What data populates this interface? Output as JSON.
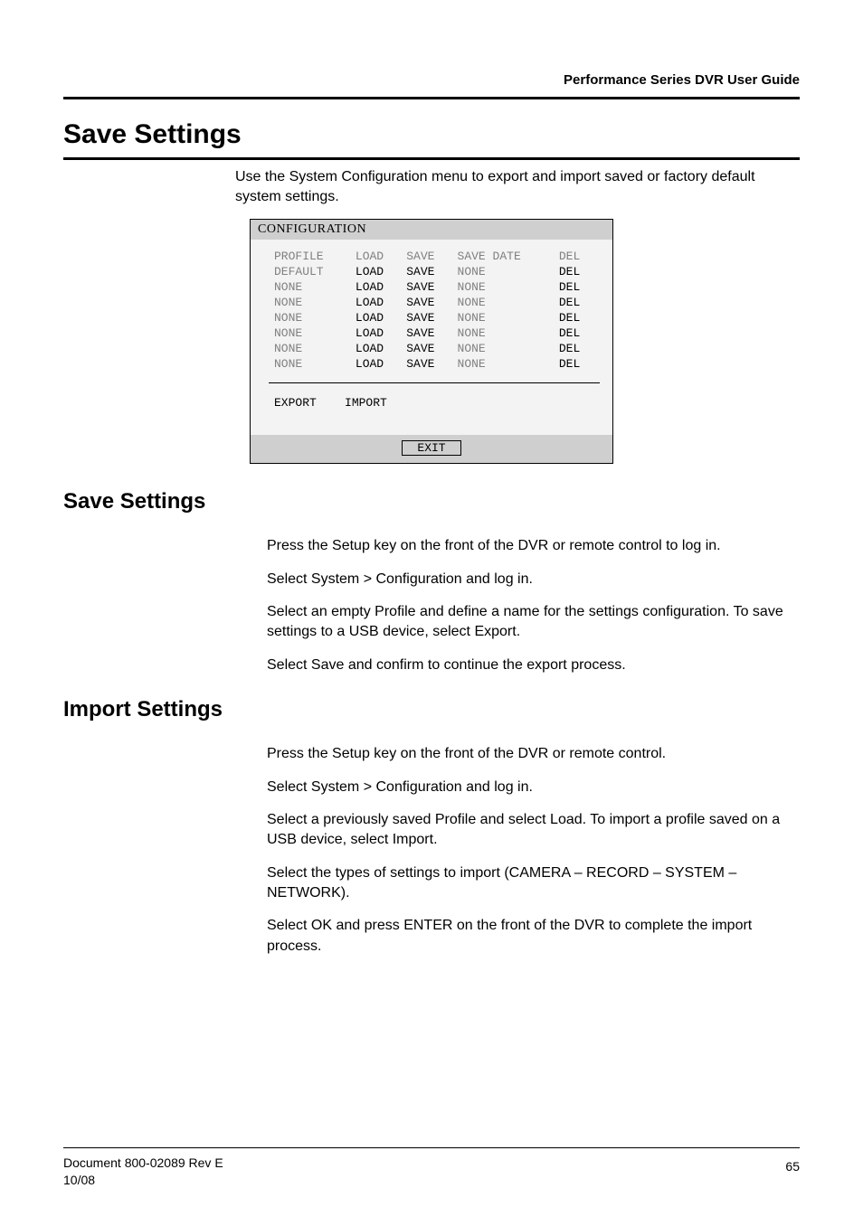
{
  "running_head": "Performance Series DVR User Guide",
  "title": "Save Settings",
  "intro": "Use the System Configuration menu to export and import saved or factory default system settings.",
  "cfg": {
    "header": "CONFIGURATION",
    "cols": [
      "PROFILE",
      "LOAD",
      "SAVE",
      "SAVE DATE",
      "DEL"
    ],
    "rows": [
      {
        "profile": "DEFAULT",
        "load": "LOAD",
        "save": "SAVE",
        "date": "NONE",
        "del": "DEL"
      },
      {
        "profile": "NONE",
        "load": "LOAD",
        "save": "SAVE",
        "date": "NONE",
        "del": "DEL"
      },
      {
        "profile": "NONE",
        "load": "LOAD",
        "save": "SAVE",
        "date": "NONE",
        "del": "DEL"
      },
      {
        "profile": "NONE",
        "load": "LOAD",
        "save": "SAVE",
        "date": "NONE",
        "del": "DEL"
      },
      {
        "profile": "NONE",
        "load": "LOAD",
        "save": "SAVE",
        "date": "NONE",
        "del": "DEL"
      },
      {
        "profile": "NONE",
        "load": "LOAD",
        "save": "SAVE",
        "date": "NONE",
        "del": "DEL"
      },
      {
        "profile": "NONE",
        "load": "LOAD",
        "save": "SAVE",
        "date": "NONE",
        "del": "DEL"
      }
    ],
    "export": "EXPORT",
    "import": "IMPORT",
    "exit": "EXIT"
  },
  "sections": {
    "save": {
      "heading": "Save Settings",
      "steps": [
        "Press the Setup key on the front of the DVR or remote control to log in.",
        "Select System > Configuration and log in.",
        "Select an empty Profile and define a name for the settings configuration. To save settings to a USB device, select Export.",
        "Select Save and confirm to continue the export process."
      ]
    },
    "import": {
      "heading": "Import Settings",
      "steps": [
        "Press the Setup key on the front of the DVR or remote control.",
        "Select System > Configuration and log in.",
        "Select a previously saved Profile and select Load. To import a profile saved on a USB device, select Import.",
        "Select the types of settings to import (CAMERA – RECORD – SYSTEM – NETWORK).",
        "Select OK and press ENTER on the front of the DVR to complete the import process."
      ]
    }
  },
  "footer": {
    "doc": "Document 800-02089  Rev E",
    "date": "10/08",
    "page": "65"
  }
}
